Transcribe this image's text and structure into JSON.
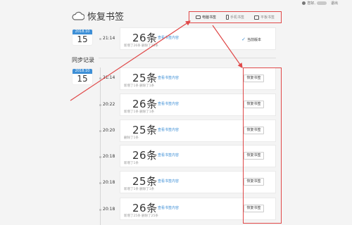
{
  "header": {
    "user_label": "您好,",
    "logout": "退出",
    "title": "恢复书签"
  },
  "device_tabs": [
    {
      "label": "电脑书签",
      "icon": "monitor-icon",
      "active": true
    },
    {
      "label": "手机书签",
      "icon": "phone-icon",
      "active": false
    },
    {
      "label": "平板书签",
      "icon": "tablet-icon",
      "active": false
    }
  ],
  "current": {
    "date_ym": "2018.10",
    "date_day": "15",
    "time": "21:14",
    "count": "26条",
    "view_link": "查看书签内容",
    "sub": "新增了26条   删除了25条",
    "current_label": "当前版本"
  },
  "sync": {
    "section_label": "同步记录",
    "date_ym": "2018.10",
    "date_day": "15",
    "records": [
      {
        "time": "21:14",
        "count": "25条",
        "view_link": "查看书签内容",
        "sub": "新增了1条   删除了1条",
        "restore": "恢复书签"
      },
      {
        "time": "20:22",
        "count": "26条",
        "view_link": "查看书签内容",
        "sub": "新增了1条   删除了1条",
        "restore": "恢复书签"
      },
      {
        "time": "20:20",
        "count": "25条",
        "view_link": "查看书签内容",
        "sub": "删除了1条",
        "restore": "恢复书签"
      },
      {
        "time": "20:18",
        "count": "26条",
        "view_link": "查看书签内容",
        "sub": "新增了1条",
        "restore": "恢复书签"
      },
      {
        "time": "20:18",
        "count": "25条",
        "view_link": "查看书签内容",
        "sub": "新增了1条   删除了1条",
        "restore": "恢复书签"
      },
      {
        "time": "20:18",
        "count": "26条",
        "view_link": "查看书签内容",
        "sub": "新增了25条   删除了25条",
        "restore": "恢复书签"
      }
    ]
  },
  "colors": {
    "accent": "#3d8fd6",
    "annotation": "#e04848"
  }
}
